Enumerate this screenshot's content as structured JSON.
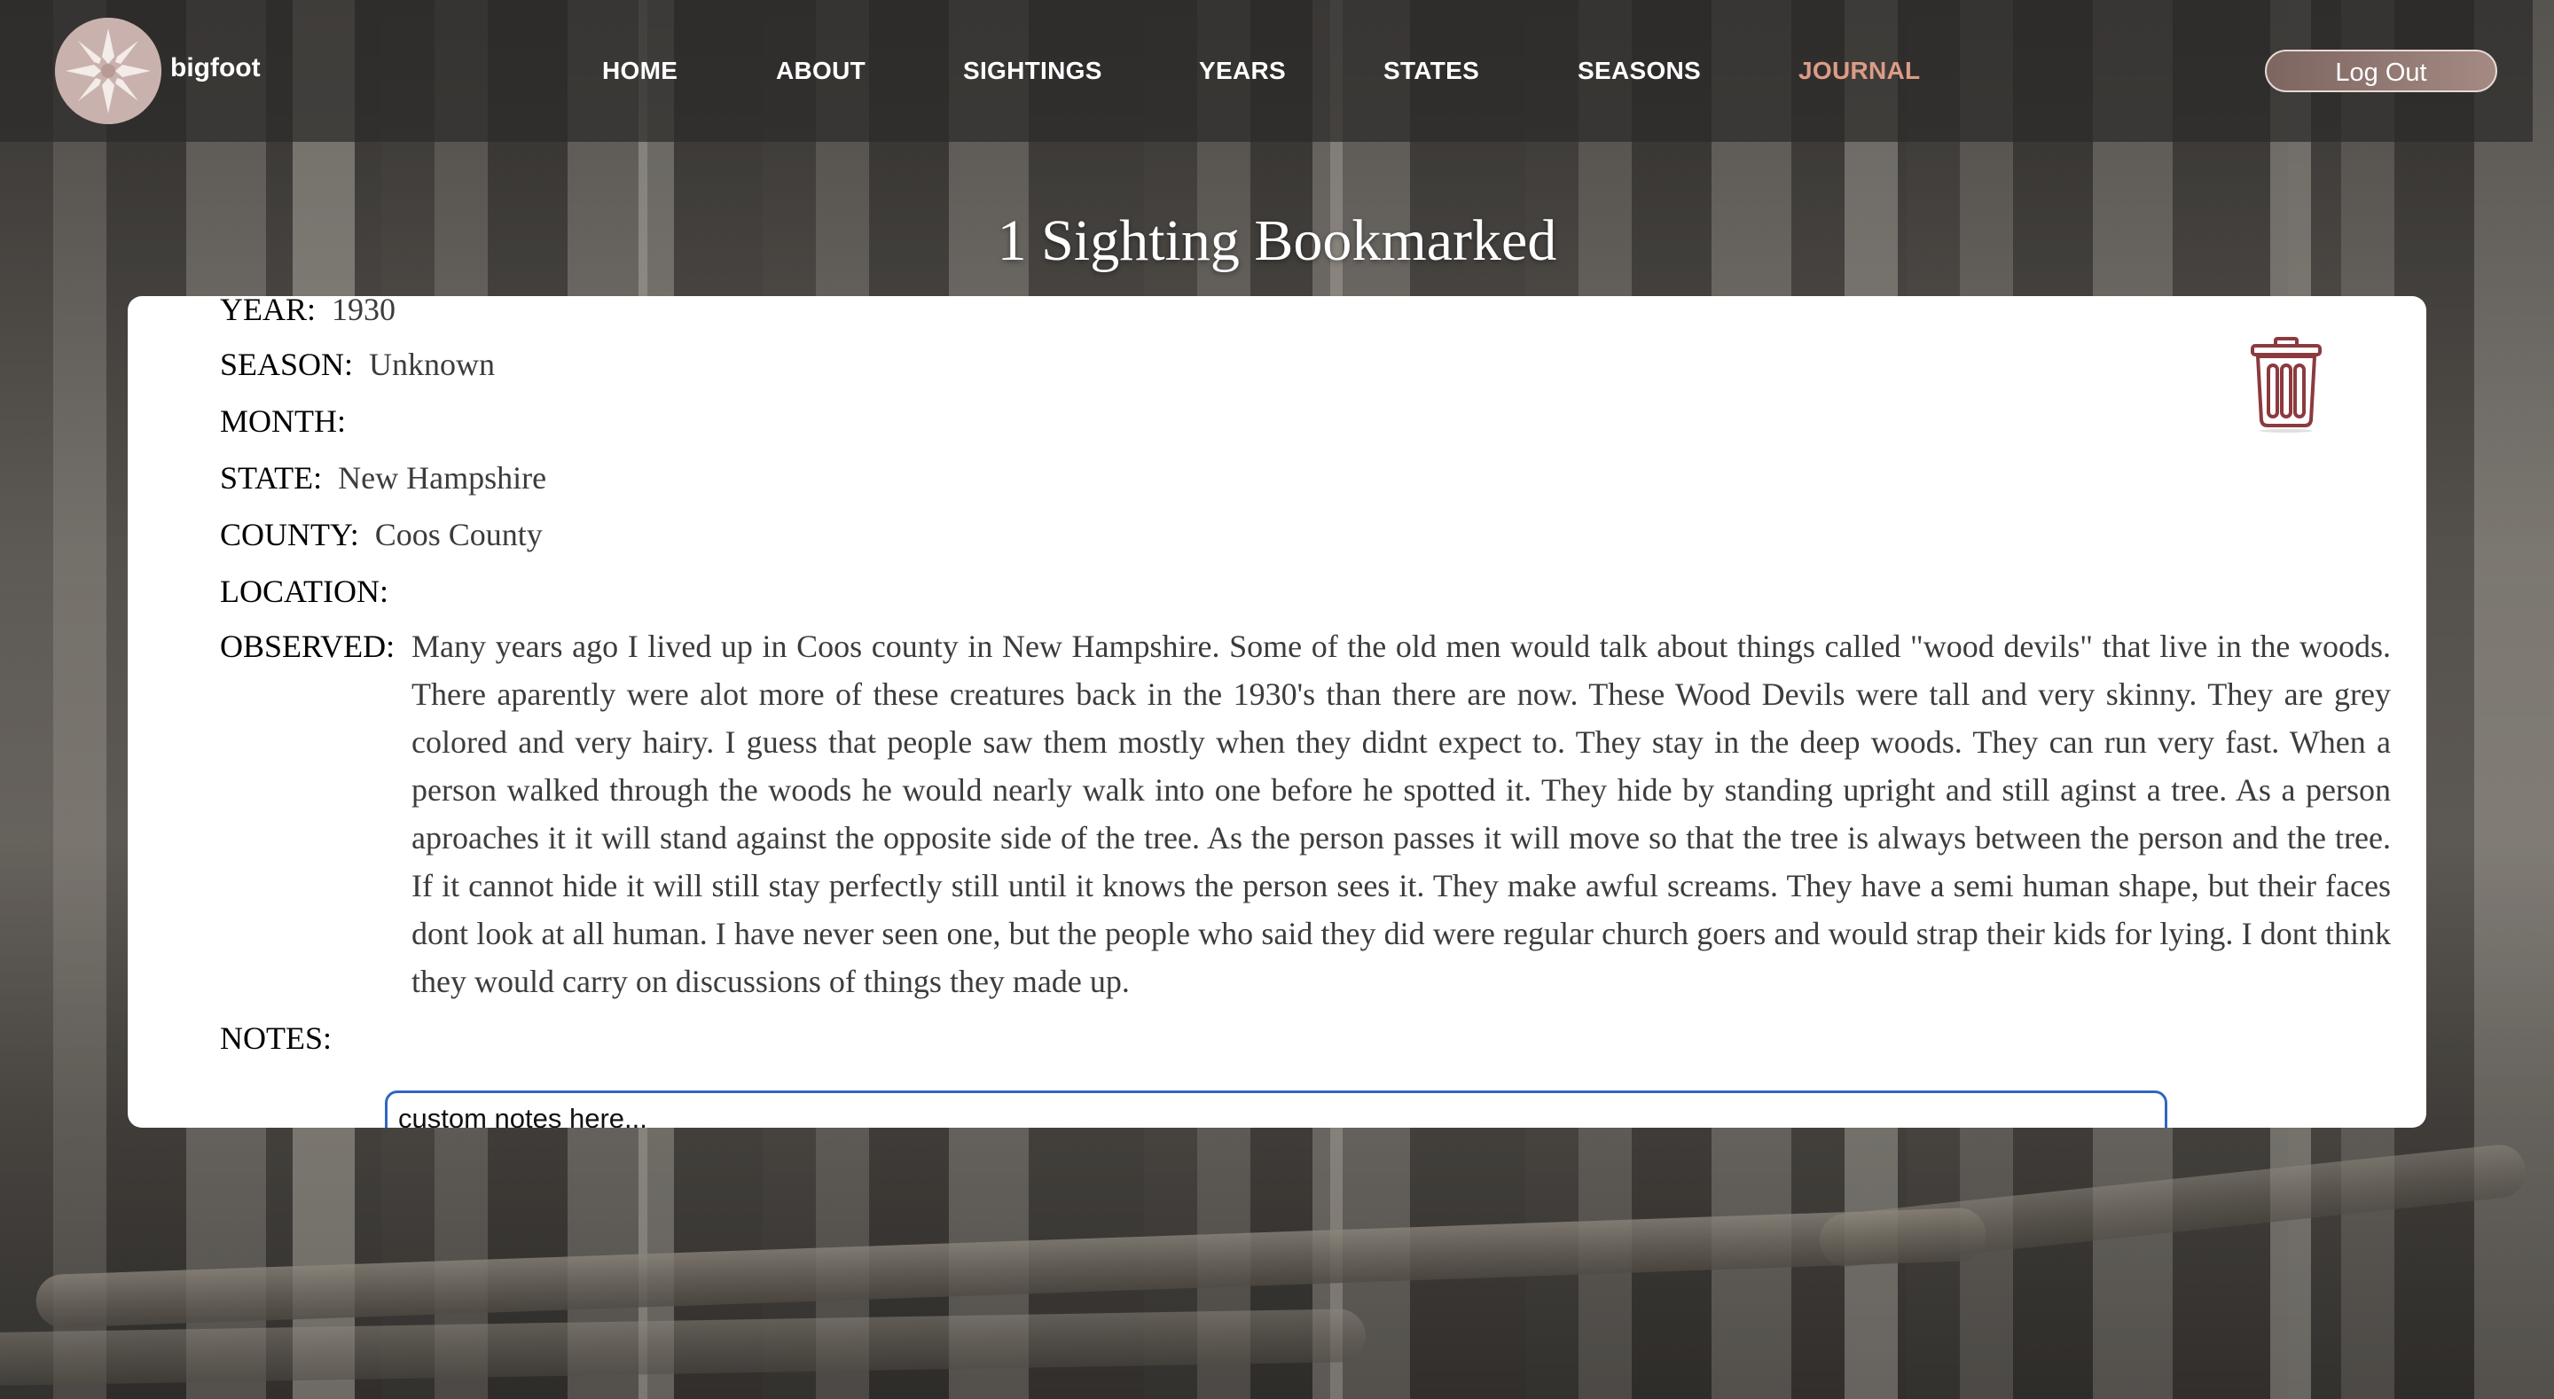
{
  "header": {
    "brand": "bigfoot",
    "nav": [
      {
        "label": "HOME",
        "active": false
      },
      {
        "label": "ABOUT",
        "active": false
      },
      {
        "label": "SIGHTINGS",
        "active": false
      },
      {
        "label": "YEARS",
        "active": false
      },
      {
        "label": "STATES",
        "active": false
      },
      {
        "label": "SEASONS",
        "active": false
      },
      {
        "label": "JOURNAL",
        "active": true
      }
    ],
    "logout_label": "Log Out"
  },
  "page": {
    "title": "1 Sighting Bookmarked"
  },
  "sighting": {
    "year_label": "YEAR:",
    "year": "1930",
    "season_label": "SEASON:",
    "season": "Unknown",
    "month_label": "MONTH:",
    "month": "",
    "state_label": "STATE:",
    "state": "New Hampshire",
    "county_label": "COUNTY:",
    "county": "Coos County",
    "location_label": "LOCATION:",
    "location": "",
    "observed_label": "OBSERVED:",
    "observed": "Many years ago I lived up in Coos county in New Hampshire. Some of the old men would talk about things called \"wood devils\" that live in the woods. There aparently were alot more of these creatures back in the 1930's than there are now. These Wood Devils were tall and very skinny. They are grey colored and very hairy. I guess that people saw them mostly when they didnt expect to. They stay in the deep woods. They can run very fast. When a person walked through the woods he would nearly walk into one before he spotted it. They hide by standing upright and still aginst a tree. As a person aproaches it it will stand against the opposite side of the tree. As the person passes it will move so that the tree is always between the person and the tree. If it cannot hide it will still stay perfectly still until it knows the person sees it. They make awful screams. They have a semi human shape, but their faces dont look at all human. I have never seen one, but the people who said they did were regular church goers and would strap their kids for lying. I dont think they would carry on discussions of things they made up.",
    "notes_label": "NOTES:",
    "notes_placeholder": "custom notes here..."
  },
  "icons": {
    "logo": "bigfoot-star-logo",
    "delete": "trash-icon"
  },
  "colors": {
    "accent": "#dd9b86",
    "trash": "#8c3a3f",
    "input_border": "#2f66c3"
  }
}
